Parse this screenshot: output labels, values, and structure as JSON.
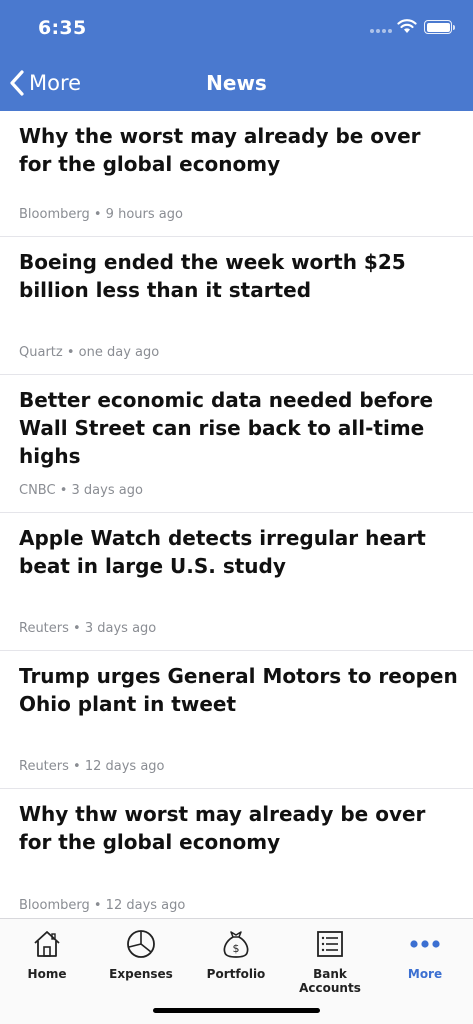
{
  "status": {
    "time": "6:35"
  },
  "nav": {
    "back_label": "More",
    "title": "News"
  },
  "news": [
    {
      "title": "Why the worst may already be over for the global economy",
      "source": "Bloomberg",
      "time": "9 hours ago"
    },
    {
      "title": "Boeing ended the week worth $25 billion less than it started",
      "source": "Quartz",
      "time": "one day ago"
    },
    {
      "title": "Better economic data needed before Wall Street can rise back to all-time highs",
      "source": "CNBC",
      "time": "3 days ago"
    },
    {
      "title": "Apple Watch detects irregular heart beat in large U.S. study",
      "source": "Reuters",
      "time": "3 days ago"
    },
    {
      "title": "Trump urges General Motors to reopen Ohio plant in tweet",
      "source": "Reuters",
      "time": "12 days ago"
    },
    {
      "title": "Why thw worst may already be over for the global economy",
      "source": "Bloomberg",
      "time": "12 days ago"
    }
  ],
  "tabs": [
    {
      "label": "Home",
      "icon": "home-icon"
    },
    {
      "label": "Expenses",
      "icon": "pie-chart-icon"
    },
    {
      "label": "Portfolio",
      "icon": "money-bag-icon"
    },
    {
      "label": "Bank Accounts",
      "icon": "list-icon"
    },
    {
      "label": "More",
      "icon": "more-dots-icon",
      "active": true
    }
  ],
  "colors": {
    "accent": "#4a79cf",
    "tab_active": "#3b6fd1",
    "meta_text": "#8a8d93"
  }
}
